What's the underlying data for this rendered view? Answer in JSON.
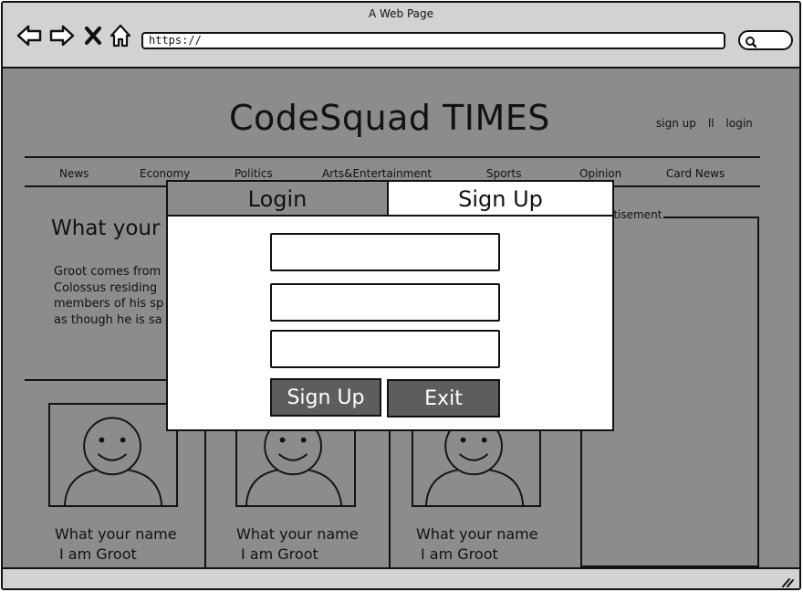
{
  "window": {
    "title": "A Web Page"
  },
  "browser": {
    "url": "https://",
    "icons": [
      "back-arrow-icon",
      "forward-arrow-icon",
      "close-x-icon",
      "home-icon",
      "search-icon",
      "resize-grip-icon"
    ]
  },
  "site": {
    "title": "CodeSquad TIMES",
    "auth": {
      "signup": "sign up",
      "separator": "ll",
      "login": "login"
    },
    "menu": [
      "News",
      "Economy",
      "Politics",
      "Arts&Entertainment",
      "Sports",
      "Opinion",
      "Card News"
    ],
    "headline": "What your n",
    "article_lines": [
      "Groot comes from",
      "Colossus residing",
      "members of his sp",
      "as though he is sa"
    ],
    "ad_label": "ertisement",
    "cards": [
      {
        "name": "What your name",
        "sub": "I am Groot"
      },
      {
        "name": "What your name",
        "sub": "I am Groot"
      },
      {
        "name": "What your name",
        "sub": "I am Groot"
      }
    ]
  },
  "modal": {
    "tabs": {
      "login": "Login",
      "signup": "Sign Up"
    },
    "fields": [
      {
        "value": "",
        "placeholder": ""
      },
      {
        "value": "",
        "placeholder": ""
      },
      {
        "value": "",
        "placeholder": ""
      }
    ],
    "buttons": {
      "signup": "Sign Up",
      "exit": "Exit"
    }
  },
  "colors": {
    "chrome": "#d2d2d2",
    "overlay": "#8a8a8a",
    "inactive_tab": "#8c8c8c",
    "button": "#5d5d5d"
  }
}
